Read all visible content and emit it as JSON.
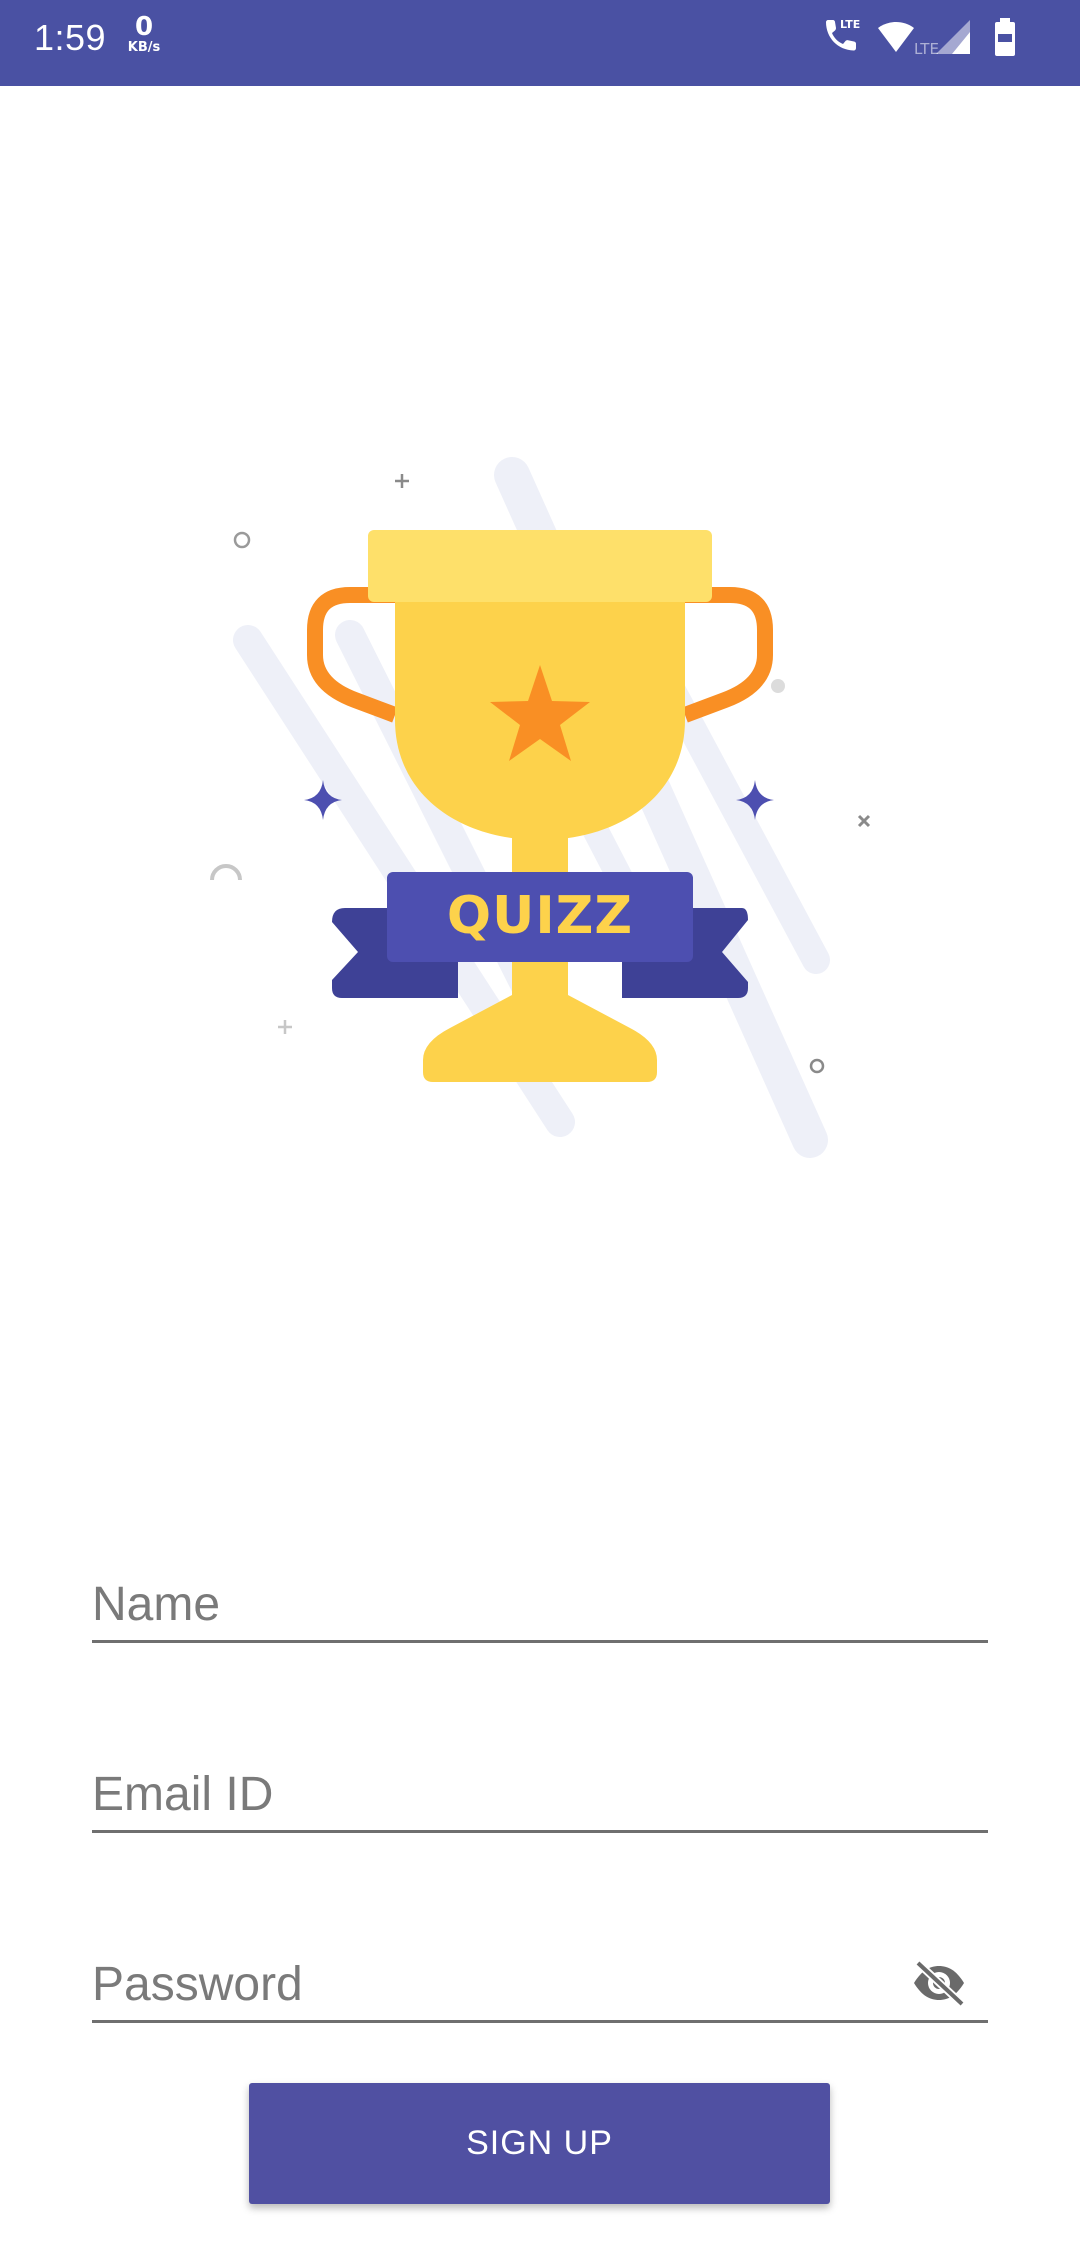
{
  "status_bar": {
    "time": "1:59",
    "net_speed_value": "0",
    "net_speed_unit": "KB/s",
    "icons": [
      "volte-call-icon",
      "wifi-icon",
      "lte-signal-icon",
      "battery-icon"
    ],
    "background": "#4a51a3",
    "lte_label": "LTE"
  },
  "illustration": {
    "badge_text": "QUIZZ",
    "colors": {
      "cup": "#fdd24b",
      "cup_rim": "#fee06a",
      "handles": "#f98f24",
      "star": "#f98f24",
      "ribbon": "#4d4fb0",
      "ribbon_dark": "#3e4196",
      "badge_text": "#fdd24b",
      "streaks": "#eef0f8"
    }
  },
  "form": {
    "name_placeholder": "Name",
    "email_placeholder": "Email ID",
    "password_placeholder": "Password",
    "signup_label": "SIGN UP",
    "accent": "#5050a2"
  }
}
